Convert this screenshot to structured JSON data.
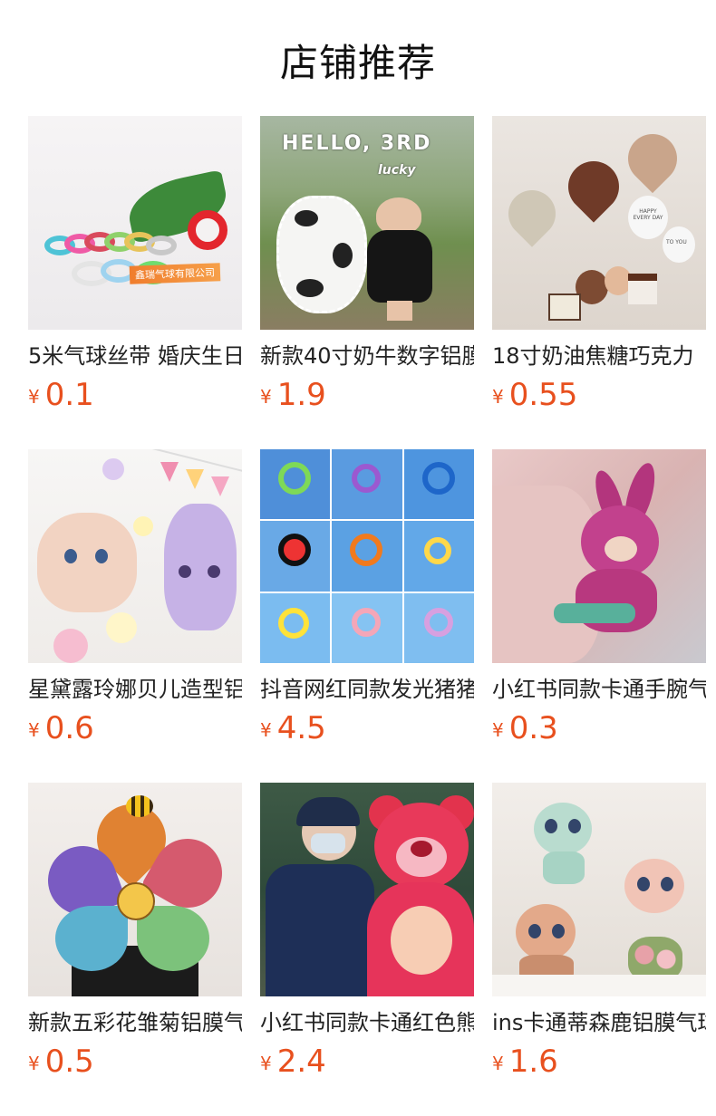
{
  "header": {
    "title": "店铺推荐"
  },
  "currency_symbol": "¥",
  "products": [
    {
      "title": "5米气球丝带 婚庆生日",
      "price": "0.1",
      "image_text": "鑫瑞气球有限公司"
    },
    {
      "title": "新款40寸奶牛数字铝膜",
      "price": "1.9",
      "image_text": "HELLO, 3RD",
      "image_subtext": "lucky"
    },
    {
      "title": "18寸奶油焦糖巧克力",
      "price": "0.55",
      "image_text": "HAPPY EVERY DAY",
      "image_subtext": "TO YOU"
    },
    {
      "title": "星黛露玲娜贝儿造型铝",
      "price": "0.6"
    },
    {
      "title": "抖音网红同款发光猪猪",
      "price": "4.5"
    },
    {
      "title": "小红书同款卡通手腕气",
      "price": "0.3"
    },
    {
      "title": "新款五彩花雏菊铝膜气",
      "price": "0.5"
    },
    {
      "title": "小红书同款卡通红色熊",
      "price": "2.4"
    },
    {
      "title": "ins卡通蒂森鹿铝膜气球",
      "price": "1.6"
    }
  ]
}
